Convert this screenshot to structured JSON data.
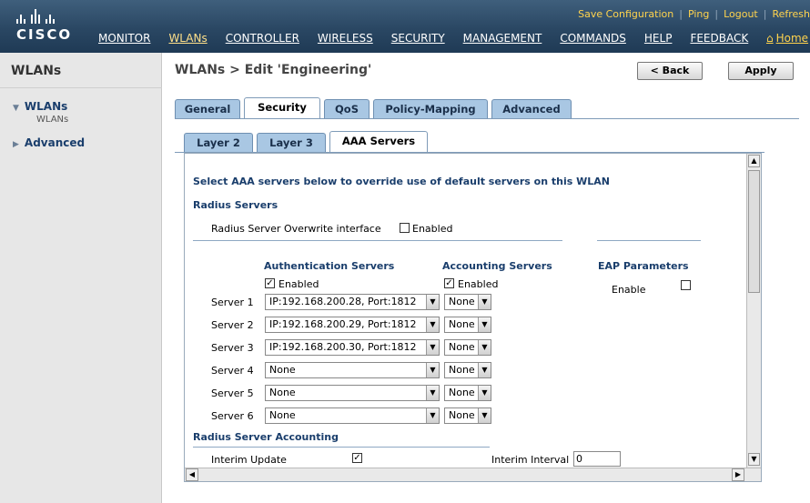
{
  "brand": {
    "logo_text": "CISCO"
  },
  "utility_links": [
    "Save Configuration",
    "Ping",
    "Logout",
    "Refresh"
  ],
  "menu": [
    "MONITOR",
    "WLANs",
    "CONTROLLER",
    "WIRELESS",
    "SECURITY",
    "MANAGEMENT",
    "COMMANDS",
    "HELP",
    "FEEDBACK"
  ],
  "home_label": "Home",
  "sidebar": {
    "title": "WLANs",
    "items": [
      {
        "label": "WLANs",
        "sub": "WLANs"
      },
      {
        "label": "Advanced"
      }
    ]
  },
  "page": {
    "title": "WLANs > Edit  'Engineering'",
    "back_label": "< Back",
    "apply_label": "Apply"
  },
  "tabs": [
    "General",
    "Security",
    "QoS",
    "Policy-Mapping",
    "Advanced"
  ],
  "subtabs": [
    "Layer 2",
    "Layer 3",
    "AAA Servers"
  ],
  "aaa": {
    "intro": "Select AAA servers below to override use of default servers on this WLAN",
    "radius_servers_heading": "Radius Servers",
    "overwrite_label": "Radius Server Overwrite interface",
    "overwrite_enabled_label": "Enabled",
    "overwrite_checked": false,
    "auth_heading": "Authentication Servers",
    "acct_heading": "Accounting Servers",
    "eap_heading": "EAP Parameters",
    "auth_enabled_label": "Enabled",
    "acct_enabled_label": "Enabled",
    "auth_enabled_checked": true,
    "acct_enabled_checked": true,
    "eap_enable_label": "Enable",
    "eap_enable_checked": false,
    "servers": [
      {
        "label": "Server 1",
        "auth": "IP:192.168.200.28, Port:1812",
        "acct": "None"
      },
      {
        "label": "Server 2",
        "auth": "IP:192.168.200.29, Port:1812",
        "acct": "None"
      },
      {
        "label": "Server 3",
        "auth": "IP:192.168.200.30, Port:1812",
        "acct": "None"
      },
      {
        "label": "Server 4",
        "auth": "None",
        "acct": "None"
      },
      {
        "label": "Server 5",
        "auth": "None",
        "acct": "None"
      },
      {
        "label": "Server 6",
        "auth": "None",
        "acct": "None"
      }
    ],
    "accounting_heading": "Radius Server Accounting",
    "interim_update_label": "Interim Update",
    "interim_update_checked": true,
    "interim_interval_label": "Interim Interval",
    "interim_interval_value": "0"
  }
}
